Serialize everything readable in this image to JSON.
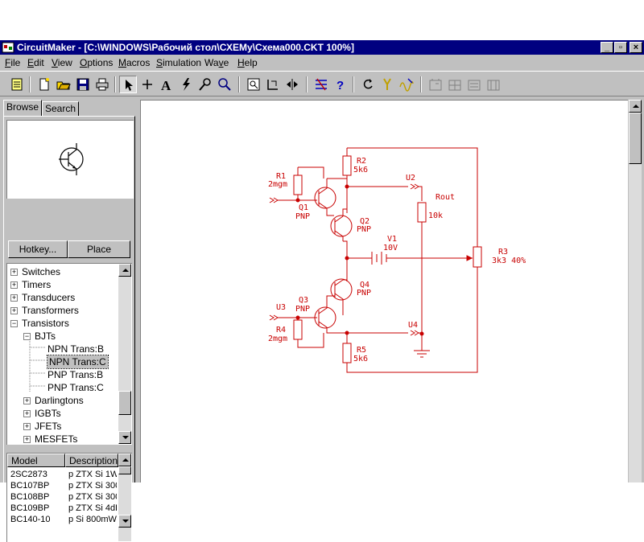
{
  "window": {
    "title": "CircuitMaker - [C:\\WINDOWS\\Рабочий стол\\СХЕМу\\Схема000.CKT 100%]",
    "controls": {
      "minimize": "_",
      "restore": "▫",
      "close": "×"
    }
  },
  "menu": [
    {
      "label": "File",
      "key": "F"
    },
    {
      "label": "Edit",
      "key": "E"
    },
    {
      "label": "View",
      "key": "V"
    },
    {
      "label": "Options",
      "key": "O"
    },
    {
      "label": "Macros",
      "key": "M"
    },
    {
      "label": "Simulation",
      "key": "S"
    },
    {
      "label": "Wave",
      "key": "v"
    },
    {
      "label": "Help",
      "key": "H"
    }
  ],
  "toolbar": {
    "icons": [
      "digital-mode-icon",
      "new-file-icon",
      "open-file-icon",
      "save-icon",
      "print-icon",
      "arrow-tool-icon",
      "wire-tool-icon",
      "text-tool-icon",
      "probe-tool-icon",
      "zoom-tool-icon",
      "search-icon",
      "zoom-fit-icon",
      "rotate-icon",
      "mirror-icon",
      "bus-icon",
      "help-icon",
      "reset-icon",
      "probe-icon",
      "wave-icon",
      "grid-1-icon",
      "grid-2-icon",
      "grid-3-icon",
      "grid-4-icon"
    ]
  },
  "panel": {
    "tabs": [
      "Browse",
      "Search"
    ],
    "hotkey_label": "Hotkey...",
    "place_label": "Place",
    "tree": [
      {
        "label": "Switches",
        "level": 0,
        "exp": "+"
      },
      {
        "label": "Timers",
        "level": 0,
        "exp": "+"
      },
      {
        "label": "Transducers",
        "level": 0,
        "exp": "+"
      },
      {
        "label": "Transformers",
        "level": 0,
        "exp": "+"
      },
      {
        "label": "Transistors",
        "level": 0,
        "exp": "−"
      },
      {
        "label": "BJTs",
        "level": 1,
        "exp": "−"
      },
      {
        "label": "NPN Trans:B",
        "level": 2,
        "exp": ""
      },
      {
        "label": "NPN Trans:C",
        "level": 2,
        "exp": "",
        "selected": true
      },
      {
        "label": "PNP Trans:B",
        "level": 2,
        "exp": ""
      },
      {
        "label": "PNP Trans:C",
        "level": 2,
        "exp": ""
      },
      {
        "label": "Darlingtons",
        "level": 1,
        "exp": "+"
      },
      {
        "label": "IGBTs",
        "level": 1,
        "exp": "+"
      },
      {
        "label": "JFETs",
        "level": 1,
        "exp": "+"
      },
      {
        "label": "MESFETs",
        "level": 1,
        "exp": "+"
      }
    ],
    "grid": {
      "headers": [
        "Model",
        "Description"
      ],
      "rows": [
        [
          "2SC2873",
          "p ZTX Si 1W"
        ],
        [
          "BC107BP",
          "p ZTX Si 300"
        ],
        [
          "BC108BP",
          "p ZTX Si 300"
        ],
        [
          "BC109BP",
          "p ZTX Si 4dE"
        ],
        [
          "BC140-10",
          "p Si 800mW"
        ]
      ]
    }
  },
  "schematic": {
    "labels": {
      "r1_name": "R1",
      "r1_value": "2mgm",
      "r2_name": "R2",
      "r2_value": "5k6",
      "r3_name": "R3",
      "r3_value": "3k3 40%",
      "r4_name": "R4",
      "r4_value": "2mgm",
      "r5_name": "R5",
      "r5_value": "5k6",
      "rout_name": "Rout",
      "rout_value": "10k",
      "v1_name": "V1",
      "v1_value": "10V",
      "u2": "U2",
      "u3": "U3",
      "u4": "U4",
      "q1_name": "Q1",
      "q1_type": "PNP",
      "q2_name": "Q2",
      "q2_type": "PNP",
      "q3_name": "Q3",
      "q3_type": "PNP",
      "q4_name": "Q4",
      "q4_type": "PNP"
    },
    "color": "#c80000"
  }
}
